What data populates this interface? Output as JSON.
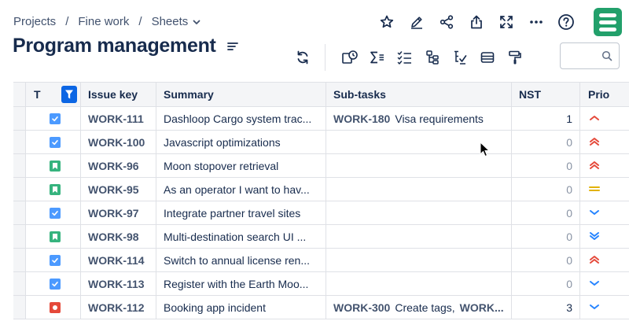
{
  "breadcrumb": {
    "items": [
      {
        "label": "Projects",
        "name": "breadcrumb-projects"
      },
      {
        "label": "Fine work",
        "name": "breadcrumb-fine-work"
      },
      {
        "label": "Sheets",
        "name": "breadcrumb-sheets"
      }
    ],
    "separator": "/"
  },
  "page": {
    "title": "Program management"
  },
  "top_actions": [
    "star-icon",
    "edit-pencil-icon",
    "share-icon",
    "export-icon",
    "fullscreen-icon",
    "more-icon",
    "help-icon"
  ],
  "toolbar": [
    "refresh-icon",
    "add-dependency-icon",
    "sum-icon",
    "checklist-icon",
    "hierarchy-icon",
    "hierarchy-check-icon",
    "card-icon",
    "paint-roller-icon"
  ],
  "search": {
    "placeholder": "",
    "value": ""
  },
  "colors": {
    "accent": "#0c66e4",
    "task": "#4c9aff",
    "story": "#36b37e",
    "bug": "#e5493a",
    "logo": "#22a06b",
    "prio_high": "#e5493a",
    "prio_medium": "#e2b203",
    "prio_low": "#2684ff"
  },
  "table": {
    "headers": {
      "type": "T",
      "key": "Issue key",
      "summary": "Summary",
      "subtasks": "Sub-tasks",
      "nst": "NST",
      "priority": "Prio"
    },
    "rows": [
      {
        "type": "task",
        "key": "WORK-111",
        "summary": "Dashloop Cargo system trac...",
        "subtasks": [
          {
            "key": "WORK-180",
            "summary": "Visa requirements"
          }
        ],
        "nst": "1",
        "priority": "high"
      },
      {
        "type": "task",
        "key": "WORK-100",
        "summary": "Javascript optimizations",
        "subtasks": [],
        "nst": "0",
        "priority": "highest"
      },
      {
        "type": "story",
        "key": "WORK-96",
        "summary": "Moon stopover retrieval",
        "subtasks": [],
        "nst": "0",
        "priority": "highest"
      },
      {
        "type": "story",
        "key": "WORK-95",
        "summary": "As an operator I want to hav...",
        "subtasks": [],
        "nst": "0",
        "priority": "medium"
      },
      {
        "type": "task",
        "key": "WORK-97",
        "summary": "Integrate partner travel sites",
        "subtasks": [],
        "nst": "0",
        "priority": "low"
      },
      {
        "type": "story",
        "key": "WORK-98",
        "summary": "Multi-destination search UI ...",
        "subtasks": [],
        "nst": "0",
        "priority": "lowest"
      },
      {
        "type": "task",
        "key": "WORK-114",
        "summary": "Switch to annual license ren...",
        "subtasks": [],
        "nst": "0",
        "priority": "highest"
      },
      {
        "type": "task",
        "key": "WORK-113",
        "summary": "Register with the Earth Moo...",
        "subtasks": [],
        "nst": "0",
        "priority": "low"
      },
      {
        "type": "bug",
        "key": "WORK-112",
        "summary": "Booking app incident",
        "subtasks": [
          {
            "key": "WORK-300",
            "summary": "Create tags,"
          },
          {
            "key": "WORK...",
            "summary": ""
          }
        ],
        "nst": "3",
        "priority": "low"
      }
    ]
  }
}
